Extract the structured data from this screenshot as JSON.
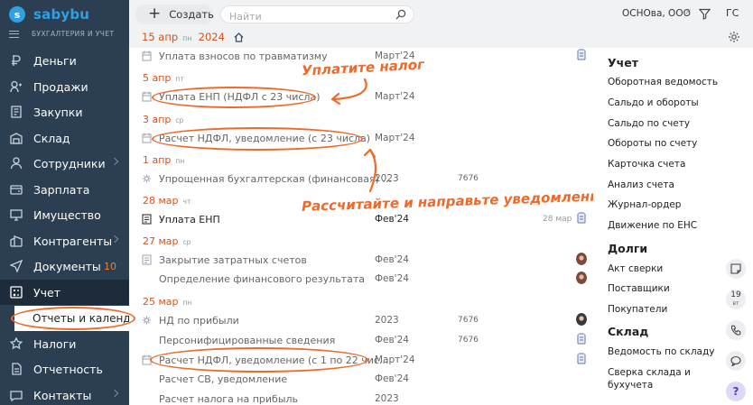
{
  "app": {
    "logo_text": "sabybu",
    "logo_letter": "s",
    "section_label": "БУХГАЛТЕРИЯ И УЧЕТ"
  },
  "sidebar": {
    "items": [
      {
        "label": "Деньги",
        "icon": "money-icon",
        "chevron": false,
        "badge": ""
      },
      {
        "label": "Продажи",
        "icon": "sales-icon",
        "chevron": false,
        "badge": ""
      },
      {
        "label": "Закупки",
        "icon": "purchases-icon",
        "chevron": false,
        "badge": ""
      },
      {
        "label": "Склад",
        "icon": "warehouse-icon",
        "chevron": false,
        "badge": ""
      },
      {
        "label": "Сотрудники",
        "icon": "employees-icon",
        "chevron": true,
        "badge": ""
      },
      {
        "label": "Зарплата",
        "icon": "salary-icon",
        "chevron": false,
        "badge": ""
      },
      {
        "label": "Имущество",
        "icon": "property-icon",
        "chevron": false,
        "badge": ""
      },
      {
        "label": "Контрагенты",
        "icon": "contractors-icon",
        "chevron": true,
        "badge": ""
      },
      {
        "label": "Документы",
        "icon": "documents-icon",
        "chevron": false,
        "badge": "10"
      },
      {
        "label": "Учет",
        "icon": "accounting-icon",
        "chevron": false,
        "badge": "",
        "active": true
      },
      {
        "label": "Налоги",
        "icon": "taxes-icon",
        "chevron": false,
        "badge": ""
      },
      {
        "label": "Отчетность",
        "icon": "reporting-icon",
        "chevron": false,
        "badge": ""
      },
      {
        "label": "Контакты",
        "icon": "contacts-icon",
        "chevron": true,
        "badge": ""
      }
    ],
    "subitem": "Отчеты и календа"
  },
  "topbar": {
    "create_label": "Создать",
    "search_placeholder": "Найти",
    "org_name": "ОСНОва, ООО",
    "org_clear": "×",
    "user_initials": "ГС"
  },
  "date_header": {
    "day": "15 апр",
    "weekday": "пн",
    "year": "2024"
  },
  "groups": [
    {
      "day": "5 апр",
      "weekday": "пт"
    },
    {
      "day": "3 апр",
      "weekday": "ср"
    },
    {
      "day": "1 апр",
      "weekday": "пн"
    },
    {
      "day": "28 мар",
      "weekday": "чт"
    },
    {
      "day": "27 мар",
      "weekday": "ср"
    },
    {
      "day": "25 мар",
      "weekday": "пн"
    }
  ],
  "rows": [
    {
      "title": "Уплата взносов по травматизму",
      "period": "Март'24",
      "num": "",
      "stat": "",
      "bold": false
    },
    {
      "title": "Уплата ЕНП (НДФЛ с 23 числа)",
      "period": "Март'24",
      "num": "",
      "stat": "",
      "bold": false
    },
    {
      "title": "Расчет НДФЛ, уведомление (с 23 числа)",
      "period": "Март'24",
      "num": "",
      "stat": "",
      "bold": false
    },
    {
      "title": "Упрощенная бухгалтерская (финансовая) ...",
      "period": "2023",
      "num": "7676",
      "stat": "",
      "bold": false
    },
    {
      "title": "Уплата ЕНП",
      "period": "Фев'24",
      "num": "",
      "stat": "28 мар",
      "bold": true
    },
    {
      "title": "Закрытие затратных счетов",
      "period": "Фев'24",
      "num": "",
      "stat": "",
      "bold": false
    },
    {
      "title": "Определение финансового результата",
      "period": "Фев'24",
      "num": "",
      "stat": "",
      "bold": false
    },
    {
      "title": "НД по прибыли",
      "period": "2023",
      "num": "7676",
      "stat": "",
      "bold": false
    },
    {
      "title": "Персонифицированные сведения",
      "period": "Фев'24",
      "num": "7676",
      "stat": "",
      "bold": false
    },
    {
      "title": "Расчет НДФЛ, уведомление (с 1 по 22 чис...",
      "period": "Март'24",
      "num": "",
      "stat": "",
      "bold": false
    },
    {
      "title": "Расчет СВ, уведомление",
      "period": "Фев'24",
      "num": "",
      "stat": "",
      "bold": false
    },
    {
      "title": "Расчет налога на прибыль",
      "period": "2023",
      "num": "",
      "stat": "",
      "bold": false
    }
  ],
  "annotations": {
    "pay_tax": "Уплатите налог",
    "calc_and_send": "Рассчитайте и направьте уведомление"
  },
  "right_panel": {
    "accounting_title": "Учет",
    "accounting_links": [
      "Оборотная ведомость",
      "Сальдо и обороты",
      "Сальдо по счету",
      "Обороты по счету",
      "Карточка счета",
      "Анализ счета",
      "Журнал-ордер",
      "Движение по ЕНС"
    ],
    "debts_title": "Долги",
    "debts_links": [
      "Акт сверки",
      "Поставщики",
      "Покупатели"
    ],
    "stock_title": "Склад",
    "stock_links": [
      "Ведомость по складу",
      "Сверка склада и бухучета"
    ],
    "calendar_day": "19",
    "calendar_wd": "вт",
    "help": "?"
  },
  "colors": {
    "sidebar_bg": "#2c3e52",
    "accent_orange": "#ee6a2a",
    "date_color": "#d2541b",
    "logo_blue": "#2ea0e6"
  }
}
